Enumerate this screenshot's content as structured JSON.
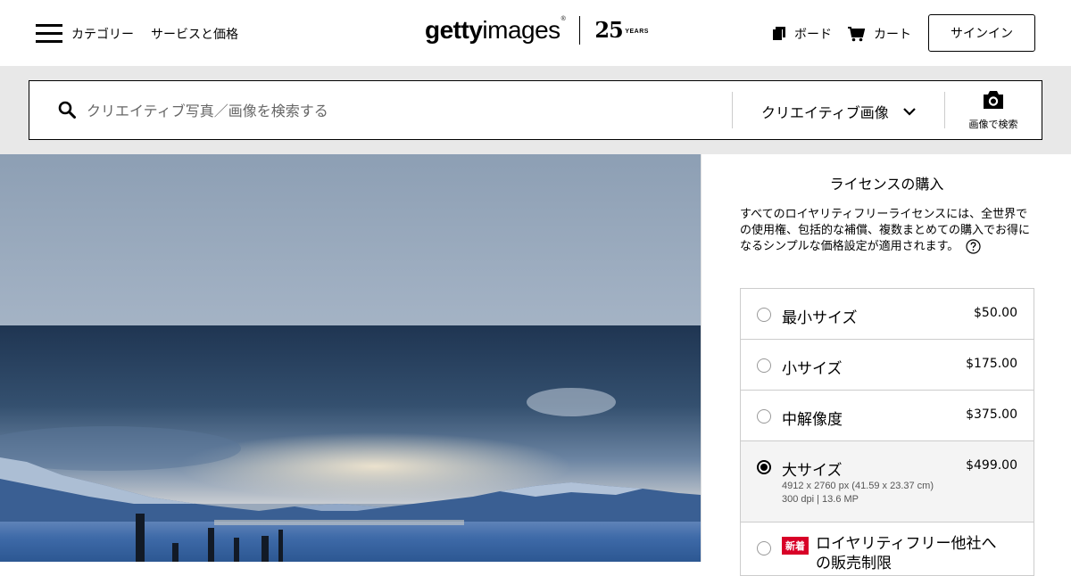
{
  "header": {
    "categories": "カテゴリー",
    "services": "サービスと価格",
    "logo_text_bold": "getty",
    "logo_text_light": "images",
    "logo_reg": "®",
    "logo_25": "25",
    "logo_years": "YEARS",
    "boards": "ボード",
    "cart": "カート",
    "signin": "サインイン"
  },
  "search": {
    "placeholder": "クリエイティブ写真／画像を検索する",
    "type_label": "クリエイティブ画像",
    "image_search_label": "画像で検索"
  },
  "panel": {
    "title": "ライセンスの購入",
    "description": "すべてのロイヤリティフリーライセンスには、全世界での使用権、包括的な補償、複数まとめての購入でお得になるシンプルな価格設定が適用されます。",
    "options": [
      {
        "name": "最小サイズ",
        "price": "$50.00"
      },
      {
        "name": "小サイズ",
        "price": "$175.00"
      },
      {
        "name": "中解像度",
        "price": "$375.00"
      },
      {
        "name": "大サイズ",
        "price": "$499.00",
        "meta1": "4912 x 2760 px (41.59 x 23.37 cm)",
        "meta2": "300 dpi | 13.6 MP",
        "selected": true
      },
      {
        "badge": "新着",
        "name": "ロイヤリティフリー他社への販売制限"
      }
    ]
  },
  "colors": {
    "badge_red": "#d80027",
    "band_gray": "#e8e8e8"
  }
}
